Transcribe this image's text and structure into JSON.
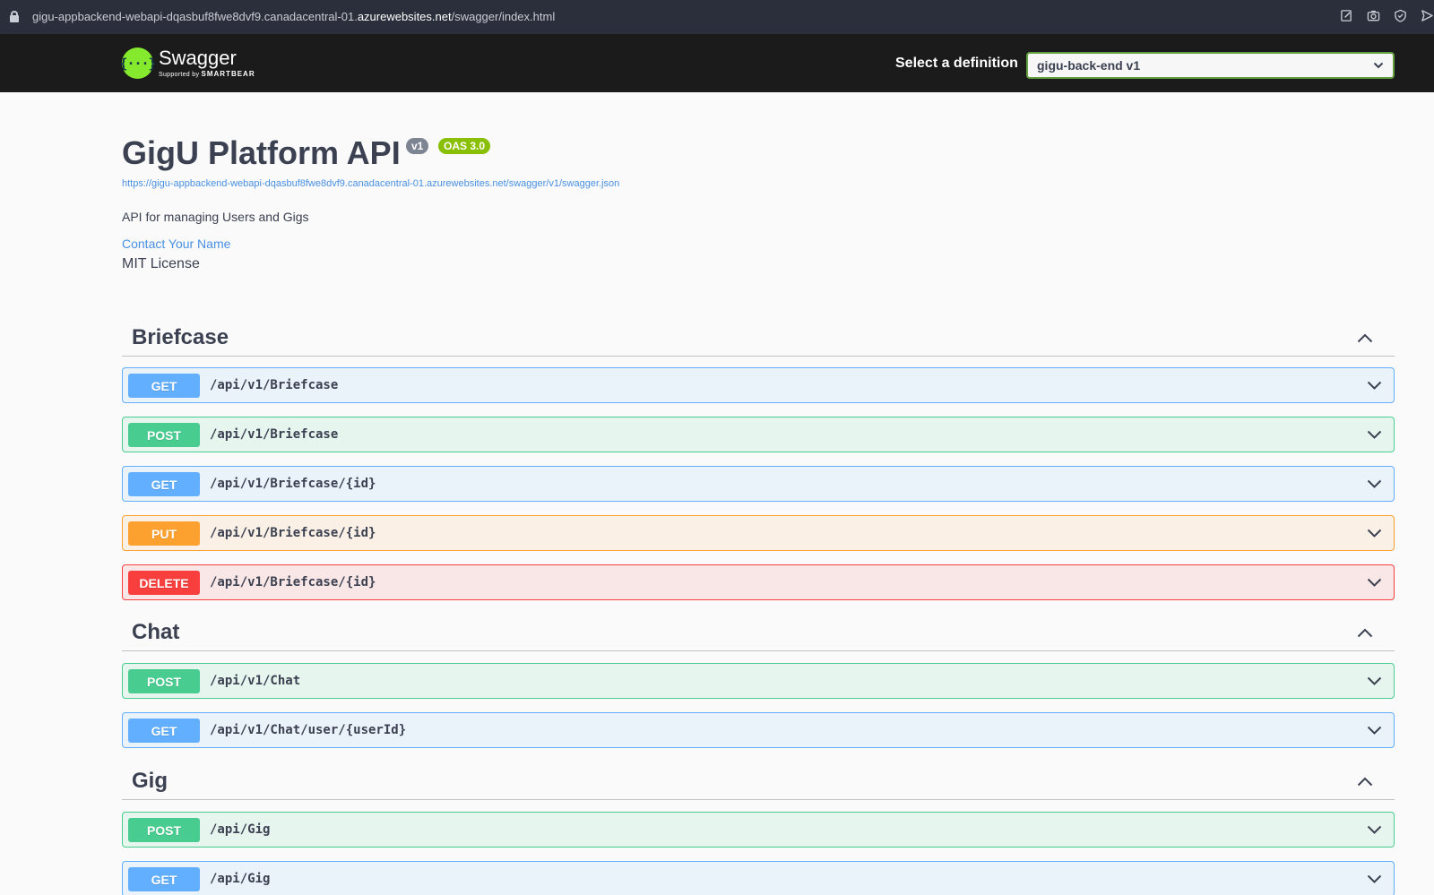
{
  "browser": {
    "url_prefix": "gigu-appbackend-webapi-dqasbuf8fwe8dvf9.canadacentral-01.",
    "url_domain": "azurewebsites.net",
    "url_suffix": "/swagger/index.html"
  },
  "topbar": {
    "logo_text": "Swagger",
    "logo_sub_prefix": "Supported by",
    "logo_sub_brand": "SMARTBEAR",
    "definition_label": "Select a definition",
    "definition_selected": "gigu-back-end v1"
  },
  "info": {
    "title": "GigU Platform API",
    "version": "v1",
    "oas": "OAS 3.0",
    "spec_url": "https://gigu-appbackend-webapi-dqasbuf8fwe8dvf9.canadacentral-01.azurewebsites.net/swagger/v1/swagger.json",
    "description": "API for managing Users and Gigs",
    "contact": "Contact Your Name",
    "license": "MIT License"
  },
  "tags": [
    {
      "name": "Briefcase",
      "operations": [
        {
          "method": "GET",
          "path": "/api/v1/Briefcase"
        },
        {
          "method": "POST",
          "path": "/api/v1/Briefcase"
        },
        {
          "method": "GET",
          "path": "/api/v1/Briefcase/{id}"
        },
        {
          "method": "PUT",
          "path": "/api/v1/Briefcase/{id}"
        },
        {
          "method": "DELETE",
          "path": "/api/v1/Briefcase/{id}"
        }
      ]
    },
    {
      "name": "Chat",
      "operations": [
        {
          "method": "POST",
          "path": "/api/v1/Chat"
        },
        {
          "method": "GET",
          "path": "/api/v1/Chat/user/{userId}"
        }
      ]
    },
    {
      "name": "Gig",
      "operations": [
        {
          "method": "POST",
          "path": "/api/Gig"
        },
        {
          "method": "GET",
          "path": "/api/Gig"
        }
      ]
    }
  ]
}
